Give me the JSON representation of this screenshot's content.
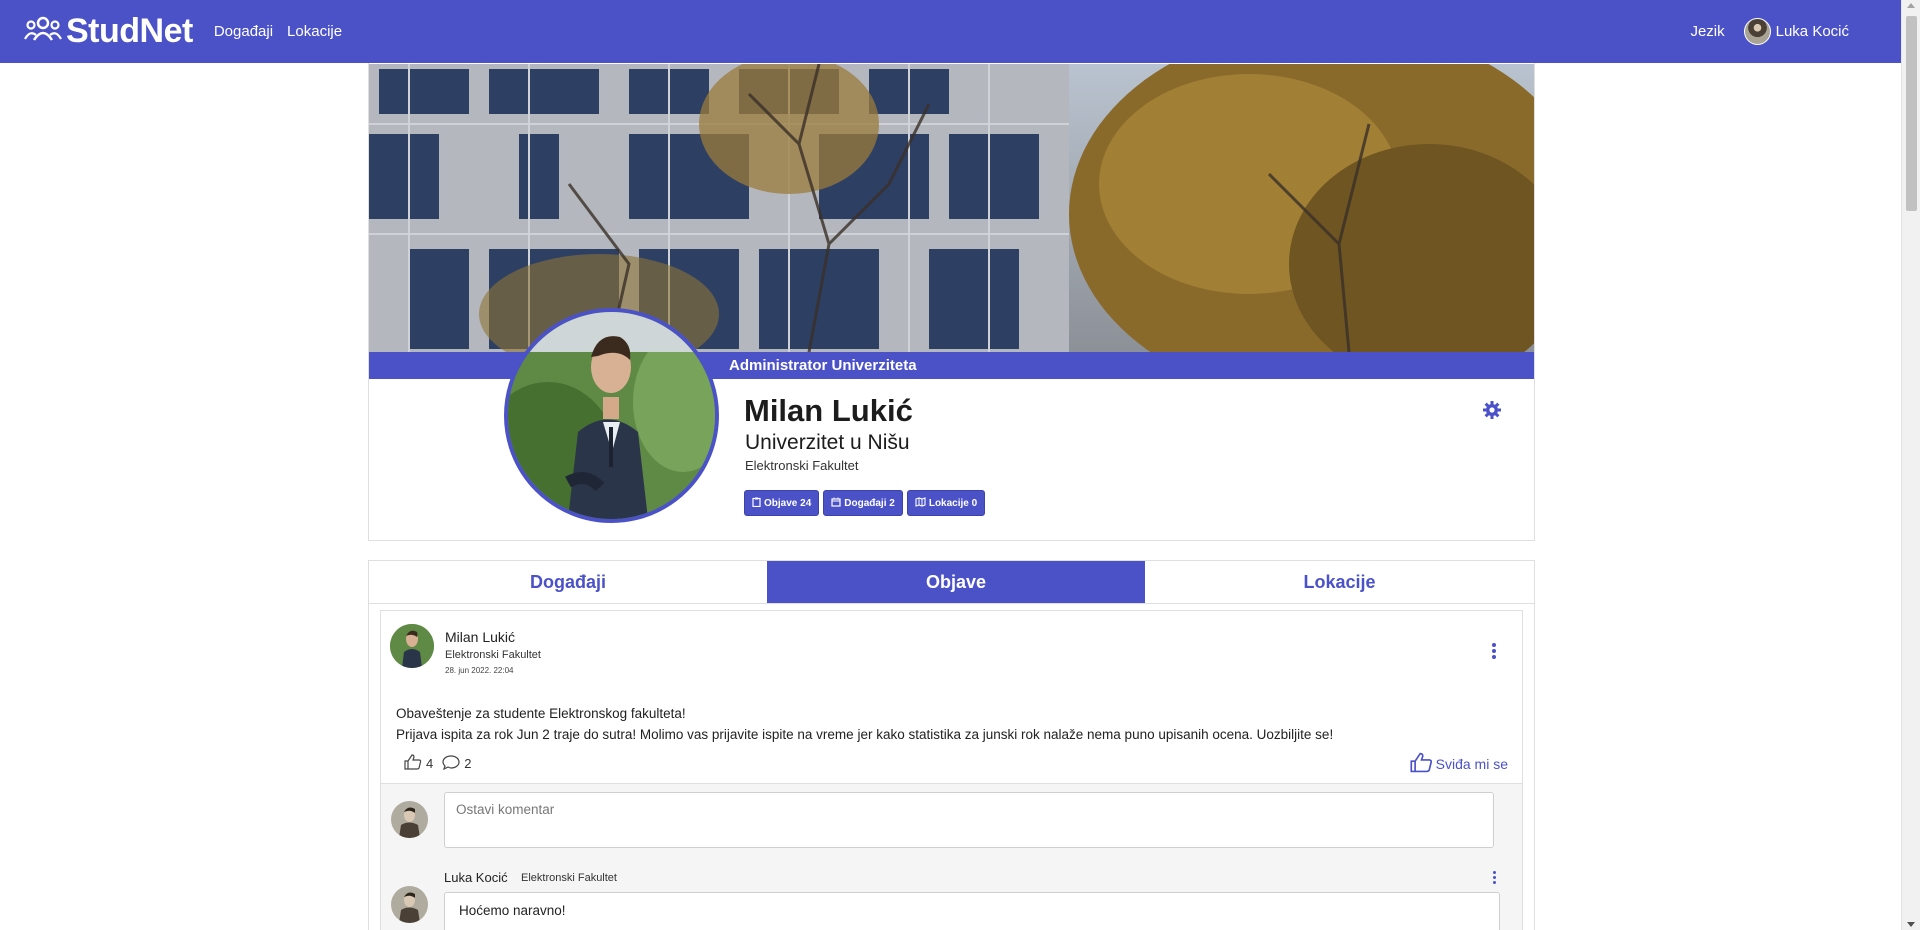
{
  "navbar": {
    "brand": "StudNet",
    "links": [
      "Događaji",
      "Lokacije"
    ],
    "language": "Jezik",
    "user_name": "Luka Kocić"
  },
  "profile": {
    "role": "Administrator Univerziteta",
    "name": "Milan Lukić",
    "university": "Univerzitet u Nišu",
    "faculty": "Elektronski Fakultet",
    "badges": {
      "posts": "Objave 24",
      "events": "Događaji 2",
      "locations": "Lokacije 0"
    }
  },
  "tabs": [
    "Događaji",
    "Objave",
    "Lokacije"
  ],
  "active_tab": "Objave",
  "post": {
    "author": "Milan Lukić",
    "faculty": "Elektronski Fakultet",
    "date": "28. jun 2022. 22:04",
    "text_line1": "Obaveštenje za studente Elektronskog fakulteta!",
    "text_line2": "Prijava ispita za rok Jun 2 traje do sutra! Molimo vas prijavite ispite na vreme jer kako statistika za junski rok nalaže nema puno upisanih ocena. Uozbiljite se!",
    "likes": "4",
    "comments_count": "2",
    "like_label": "Sviđa mi se"
  },
  "comments": {
    "input_placeholder": "Ostavi komentar",
    "items": [
      {
        "author": "Luka Kocić",
        "faculty": "Elektronski Fakultet",
        "text": "Hoćemo naravno!"
      }
    ]
  },
  "colors": {
    "primary": "#4b52c8",
    "border": "#dfdfdf"
  }
}
